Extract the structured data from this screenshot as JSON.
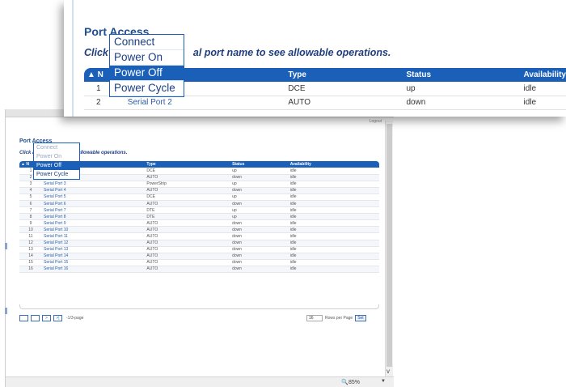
{
  "inset": {
    "title": "Port Access",
    "instruction_lead": "Click",
    "instruction_tail": "al port name to see allowable operations.",
    "columns": [
      "▲ N",
      "",
      "Type",
      "Status",
      "Availability"
    ],
    "rows": [
      {
        "num": "1",
        "name": "",
        "type": "DCE",
        "status": "up",
        "availability": "idle"
      },
      {
        "num": "2",
        "name": "Serial Port 2",
        "type": "AUTO",
        "status": "down",
        "availability": "idle"
      }
    ],
    "menu": [
      "Connect",
      "Power On",
      "Power Off",
      "Power Cycle"
    ],
    "menu_selected": "Power Off"
  },
  "background": {
    "logout": "Logout",
    "title": "Port Access",
    "instruction": "Click         al port name to see allowable operations.",
    "columns": [
      "▲ N",
      "",
      "Type",
      "Status",
      "Availability"
    ],
    "rows": [
      {
        "num": "1",
        "name": "",
        "type": "DCE",
        "status": "up",
        "availability": "idle"
      },
      {
        "num": "2",
        "name": "Serial Port 2",
        "type": "AUTO",
        "status": "down",
        "availability": "idle"
      },
      {
        "num": "3",
        "name": "Serial Port 3",
        "type": "PowerStrip",
        "status": "up",
        "availability": "idle"
      },
      {
        "num": "4",
        "name": "Serial Port 4",
        "type": "AUTO",
        "status": "down",
        "availability": "idle"
      },
      {
        "num": "5",
        "name": "Serial Port 5",
        "type": "DCE",
        "status": "up",
        "availability": "idle"
      },
      {
        "num": "6",
        "name": "Serial Port 6",
        "type": "AUTO",
        "status": "down",
        "availability": "idle"
      },
      {
        "num": "7",
        "name": "Serial Port 7",
        "type": "DTE",
        "status": "up",
        "availability": "idle"
      },
      {
        "num": "8",
        "name": "Serial Port 8",
        "type": "DTE",
        "status": "up",
        "availability": "idle"
      },
      {
        "num": "9",
        "name": "Serial Port 9",
        "type": "AUTO",
        "status": "down",
        "availability": "idle"
      },
      {
        "num": "10",
        "name": "Serial Port 10",
        "type": "AUTO",
        "status": "down",
        "availability": "idle"
      },
      {
        "num": "11",
        "name": "Serial Port 11",
        "type": "AUTO",
        "status": "down",
        "availability": "idle"
      },
      {
        "num": "12",
        "name": "Serial Port 12",
        "type": "AUTO",
        "status": "down",
        "availability": "idle"
      },
      {
        "num": "13",
        "name": "Serial Port 13",
        "type": "AUTO",
        "status": "down",
        "availability": "idle"
      },
      {
        "num": "14",
        "name": "Serial Port 14",
        "type": "AUTO",
        "status": "down",
        "availability": "idle"
      },
      {
        "num": "15",
        "name": "Serial Port 15",
        "type": "AUTO",
        "status": "down",
        "availability": "idle"
      },
      {
        "num": "16",
        "name": "Serial Port 16",
        "type": "AUTO",
        "status": "down",
        "availability": "idle"
      }
    ],
    "menu": [
      "Connect",
      "Power On",
      "Power Off",
      "Power Cycle"
    ],
    "menu_selected": "Power Off",
    "pager": {
      "buttons": [
        "",
        "",
        ">",
        ">|"
      ],
      "label": "-1/3-page"
    },
    "rows_per_page": {
      "value": "16",
      "label": "Rows per Page",
      "set_label": "Set"
    },
    "zoom": "85%",
    "zoom_dropdown": "▼",
    "scroll_down": "v"
  },
  "colors": {
    "accent": "#1a60b8",
    "title": "#1f4f90",
    "link": "#2a5ea8"
  }
}
